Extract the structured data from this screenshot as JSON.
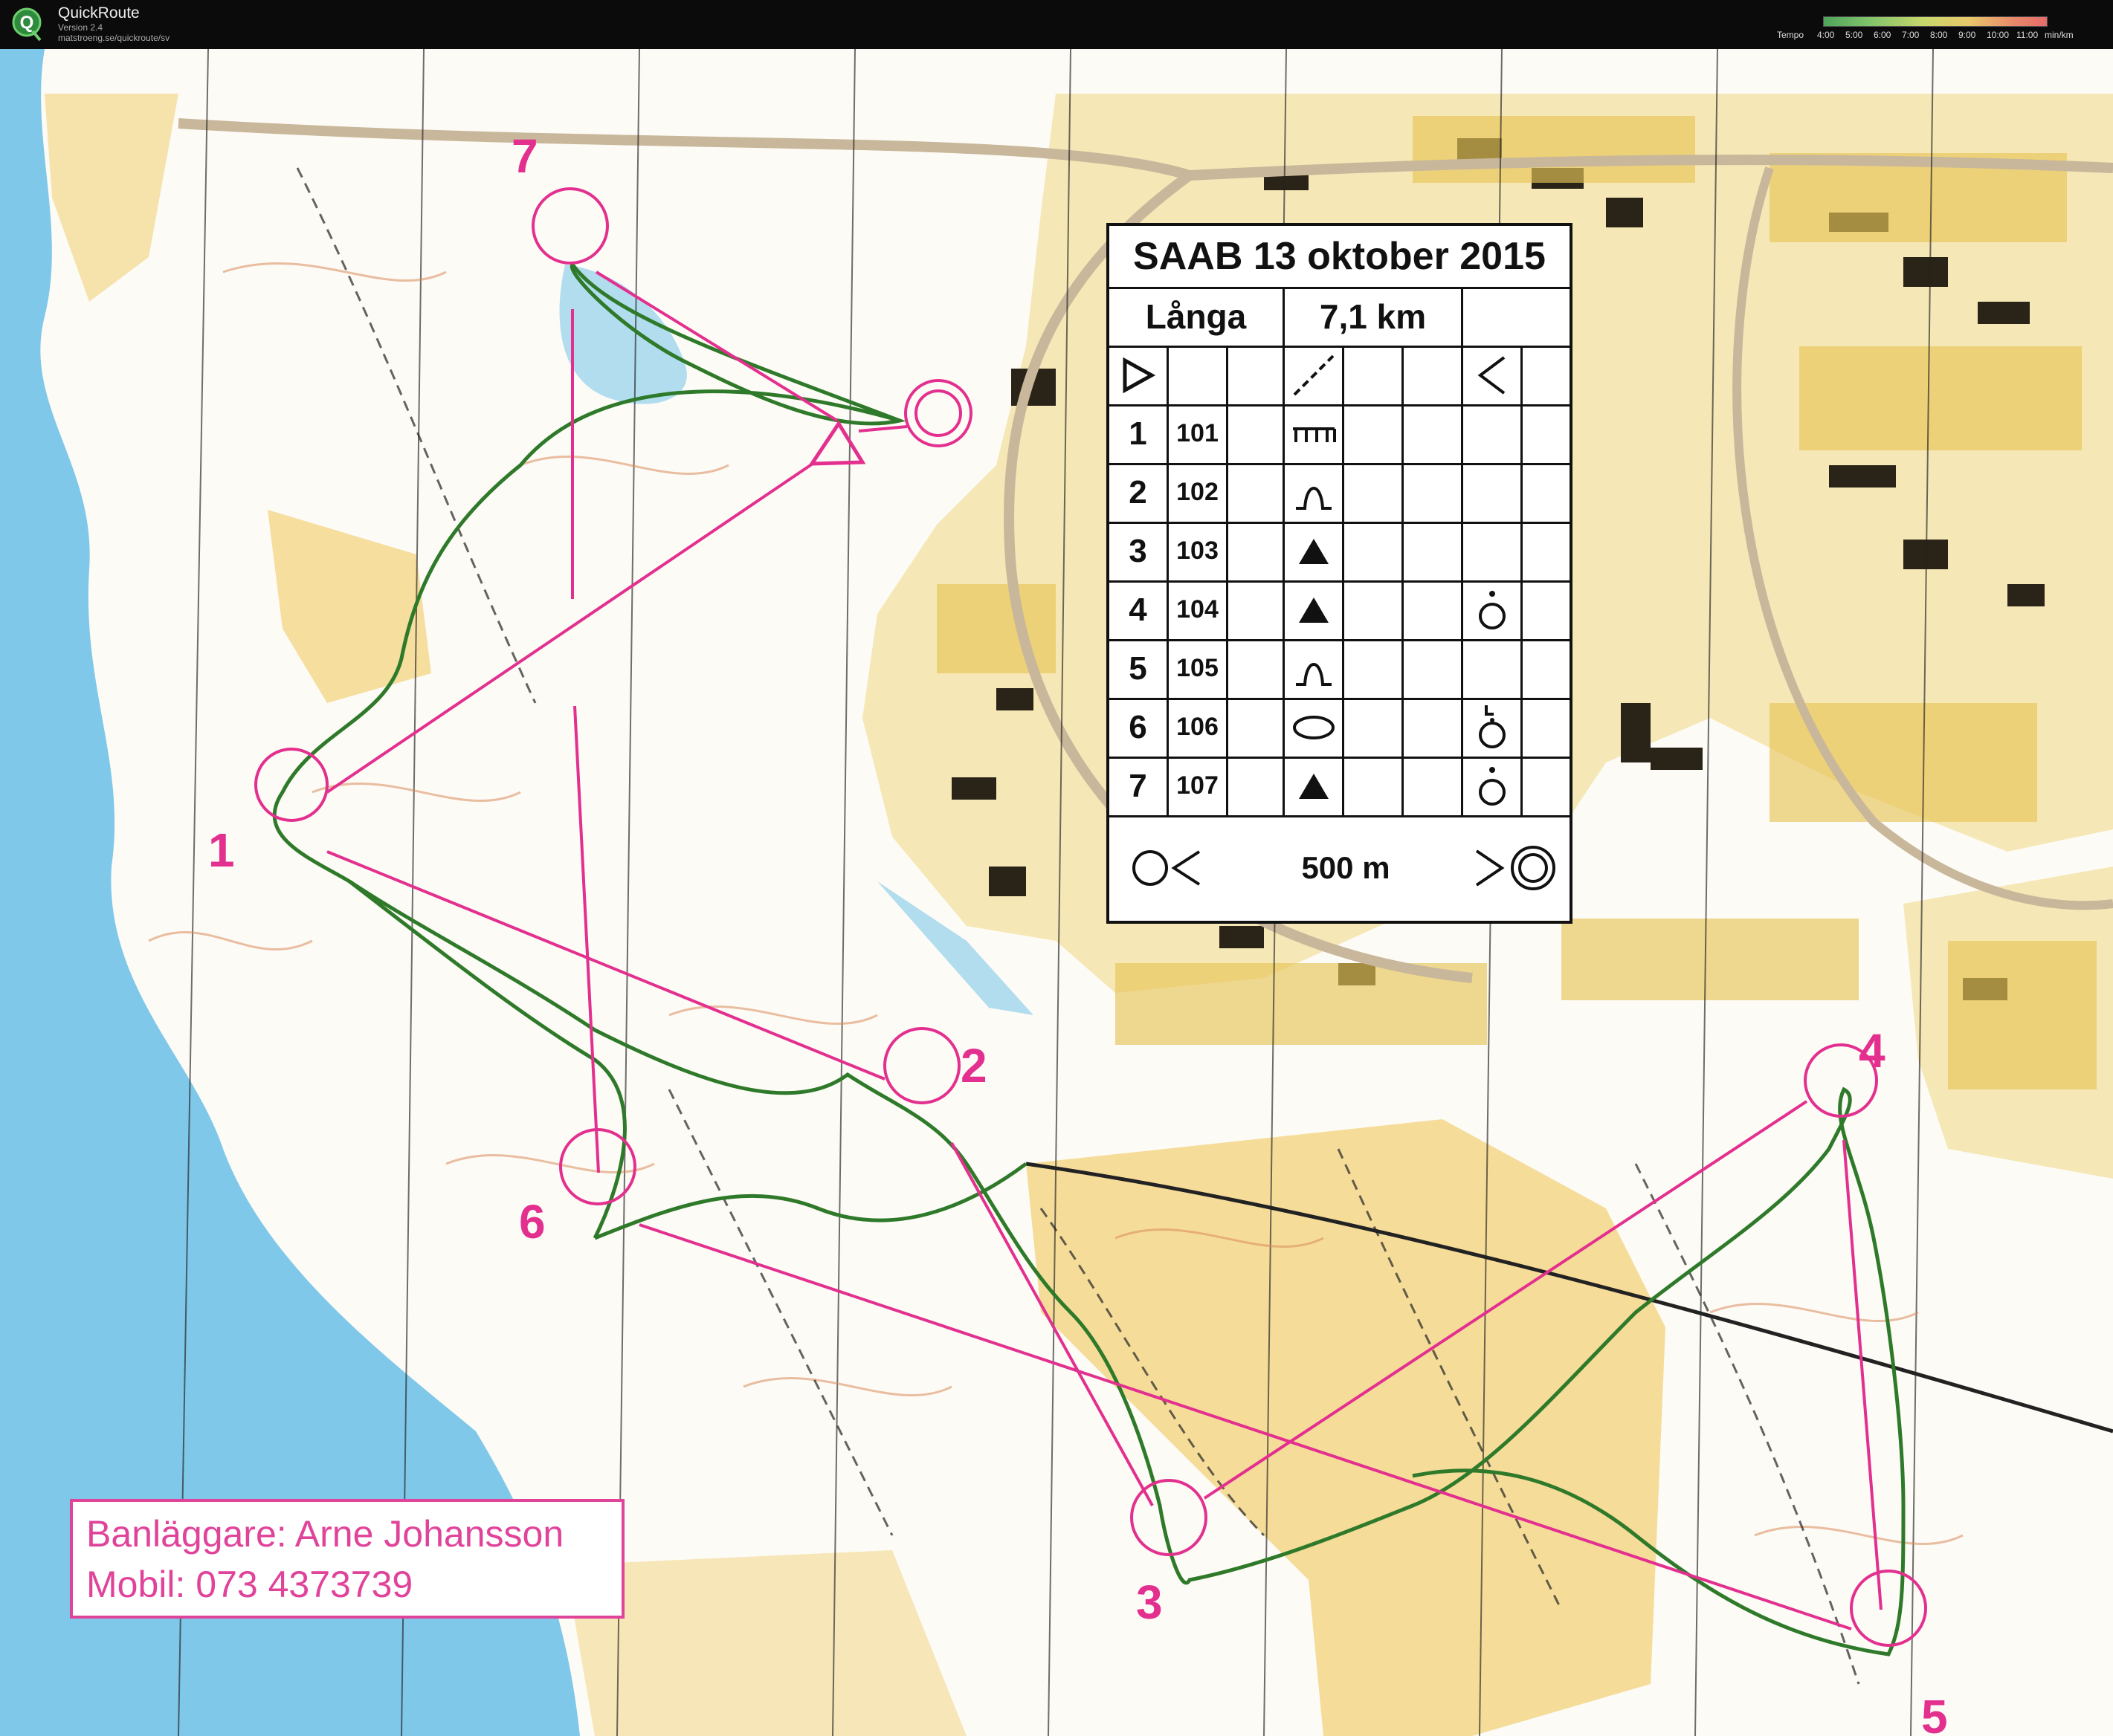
{
  "app": {
    "title": "QuickRoute",
    "version": "Version 2.4",
    "url": "matstroeng.se/quickroute/sv"
  },
  "tempo": {
    "label": "Tempo",
    "ticks": [
      "4:00",
      "5:00",
      "6:00",
      "7:00",
      "8:00",
      "9:00",
      "10:00",
      "11:00"
    ],
    "unit": "min/km"
  },
  "course": {
    "title": "SAAB 13 oktober 2015",
    "name": "Långa",
    "length": "7,1 km",
    "controls": [
      {
        "num": "1",
        "code": "101",
        "symbol": "wall-comb-icon",
        "extra": ""
      },
      {
        "num": "2",
        "code": "102",
        "symbol": "knoll-icon",
        "extra": ""
      },
      {
        "num": "3",
        "code": "103",
        "symbol": "triangle-icon",
        "extra": ""
      },
      {
        "num": "4",
        "code": "104",
        "symbol": "triangle-icon",
        "extra": "foot-icon"
      },
      {
        "num": "5",
        "code": "105",
        "symbol": "knoll-icon",
        "extra": ""
      },
      {
        "num": "6",
        "code": "106",
        "symbol": "ellipse-icon",
        "extra": "foot-L-icon"
      },
      {
        "num": "7",
        "code": "107",
        "symbol": "triangle-icon",
        "extra": "foot-icon"
      }
    ],
    "finish_distance": "500 m"
  },
  "map_labels": [
    "1",
    "2",
    "3",
    "4",
    "5",
    "6",
    "7"
  ],
  "planner": {
    "line1": "Banläggare: Arne Johansson",
    "line2": "Mobil: 073 4373739"
  },
  "colors": {
    "course": "#e3308f",
    "route": "#2f7a2a",
    "water": "#7fc8ea",
    "urban": "#d8b24a",
    "open": "#f2d27a"
  }
}
